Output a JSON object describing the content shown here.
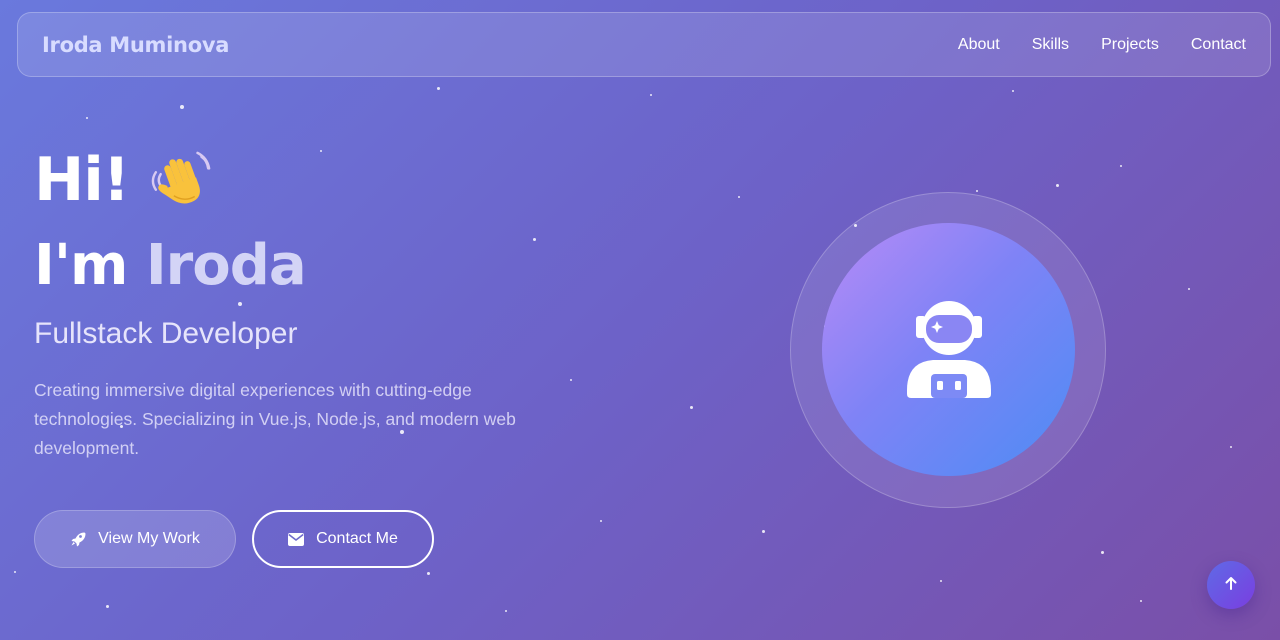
{
  "nav": {
    "brand": "Iroda Muminova",
    "links": [
      {
        "label": "About"
      },
      {
        "label": "Skills"
      },
      {
        "label": "Projects"
      },
      {
        "label": "Contact"
      }
    ]
  },
  "hero": {
    "greeting": "Hi!",
    "greeting_emoji": "waving-hand-icon",
    "name_prefix": "I'm ",
    "name": "Iroda",
    "role": "Fullstack Developer",
    "description": "Creating immersive digital experiences with cutting-edge technologies. Specializing in Vue.js, Node.js, and modern web development."
  },
  "buttons": {
    "view_work": {
      "label": "View My Work",
      "icon": "rocket-icon"
    },
    "contact": {
      "label": "Contact Me",
      "icon": "envelope-icon"
    }
  },
  "avatar": {
    "icon": "astronaut-icon"
  },
  "scroll_top": {
    "icon": "arrow-up-icon"
  },
  "colors": {
    "background_start": "#6a79dd",
    "background_end": "#7a4fa8",
    "name_highlight": "#d3d4f6",
    "avatar_gradient_start": "#b88bf7",
    "avatar_gradient_end": "#4d8cf4",
    "scroll_button": "#6a4ee4"
  }
}
